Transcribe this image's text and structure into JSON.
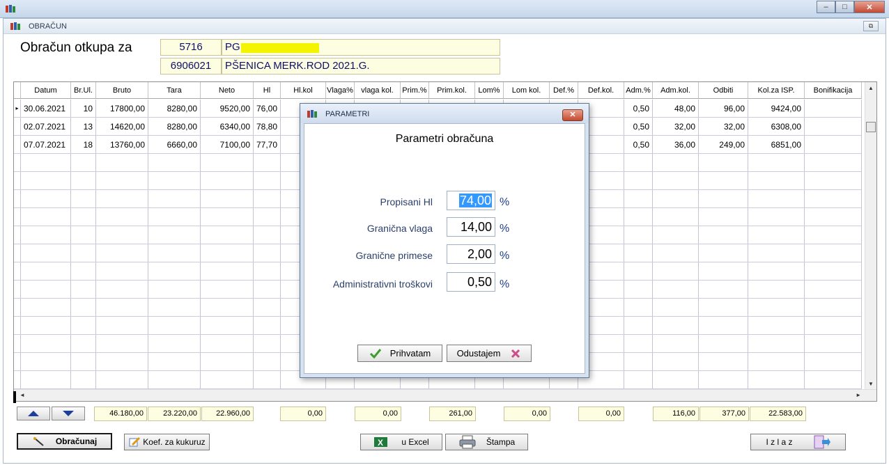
{
  "window": {
    "minimize": "–",
    "maximize": "□",
    "close": "✕"
  },
  "child": {
    "title": "OBRAČUN",
    "restore": "⧉"
  },
  "header": {
    "label": "Obračun otkupa za",
    "partner_code": "5716",
    "partner_name": "PG",
    "article_code": "6906021",
    "article_name": "PŠENICA MERK.ROD 2021.G."
  },
  "grid": {
    "columns": [
      "",
      "Datum",
      "Br.Ul.",
      "Bruto",
      "Tara",
      "Neto",
      "Hl",
      "Hl.kol",
      "Vlaga%",
      "vlaga kol.",
      "Prim.%",
      "Prim.kol.",
      "Lom%",
      "Lom kol.",
      "Def.%",
      "Def.kol.",
      "Adm.%",
      "Adm.kol.",
      "Odbiti",
      "Kol.za ISP.",
      "Bonifikacija"
    ],
    "rows": [
      [
        "▸",
        "30.06.2021",
        "10",
        "17800,00",
        "8280,00",
        "9520,00",
        "76,00",
        "",
        "",
        "",
        "",
        "",
        "",
        "",
        "",
        "",
        "0,50",
        "48,00",
        "96,00",
        "9424,00",
        ""
      ],
      [
        "",
        "02.07.2021",
        "13",
        "14620,00",
        "8280,00",
        "6340,00",
        "78,80",
        "",
        "",
        "",
        "",
        "",
        "",
        "",
        "",
        "",
        "0,50",
        "32,00",
        "32,00",
        "6308,00",
        ""
      ],
      [
        "",
        "07.07.2021",
        "18",
        "13760,00",
        "6660,00",
        "7100,00",
        "77,70",
        "",
        "",
        "",
        "",
        "",
        "",
        "",
        "",
        "",
        "0,50",
        "36,00",
        "249,00",
        "6851,00",
        ""
      ]
    ]
  },
  "totals": {
    "bruto": "46.180,00",
    "tara": "23.220,00",
    "neto": "22.960,00",
    "hl_kol": "0,00",
    "vlaga_kol": "0,00",
    "prim_kol": "261,00",
    "lom_kol": "0,00",
    "def_kol": "0,00",
    "adm_kol": "116,00",
    "odbiti": "377,00",
    "kol_za_isp": "22.583,00"
  },
  "buttons": {
    "obracunaj": "Obračunaj",
    "koef": "Koef. za kukuruz",
    "excel": "u Excel",
    "stampa": "Štampa",
    "izlaz": "I z l a z"
  },
  "dialog": {
    "title": "PARAMETRI",
    "heading": "Parametri obračuna",
    "params": [
      {
        "label": "Propisani Hl",
        "value": "74,00",
        "unit": "%"
      },
      {
        "label": "Granična vlaga",
        "value": "14,00",
        "unit": "%"
      },
      {
        "label": "Granične primese",
        "value": "2,00",
        "unit": "%"
      },
      {
        "label": "Administrativni troškovi",
        "value": "0,50",
        "unit": "%"
      }
    ],
    "accept": "Prihvatam",
    "cancel": "Odustajem",
    "close": "✕"
  },
  "colors": {
    "field_bg": "#fdfde1",
    "accent_blue": "#1f3f8a",
    "highlight": "#f4f400"
  }
}
